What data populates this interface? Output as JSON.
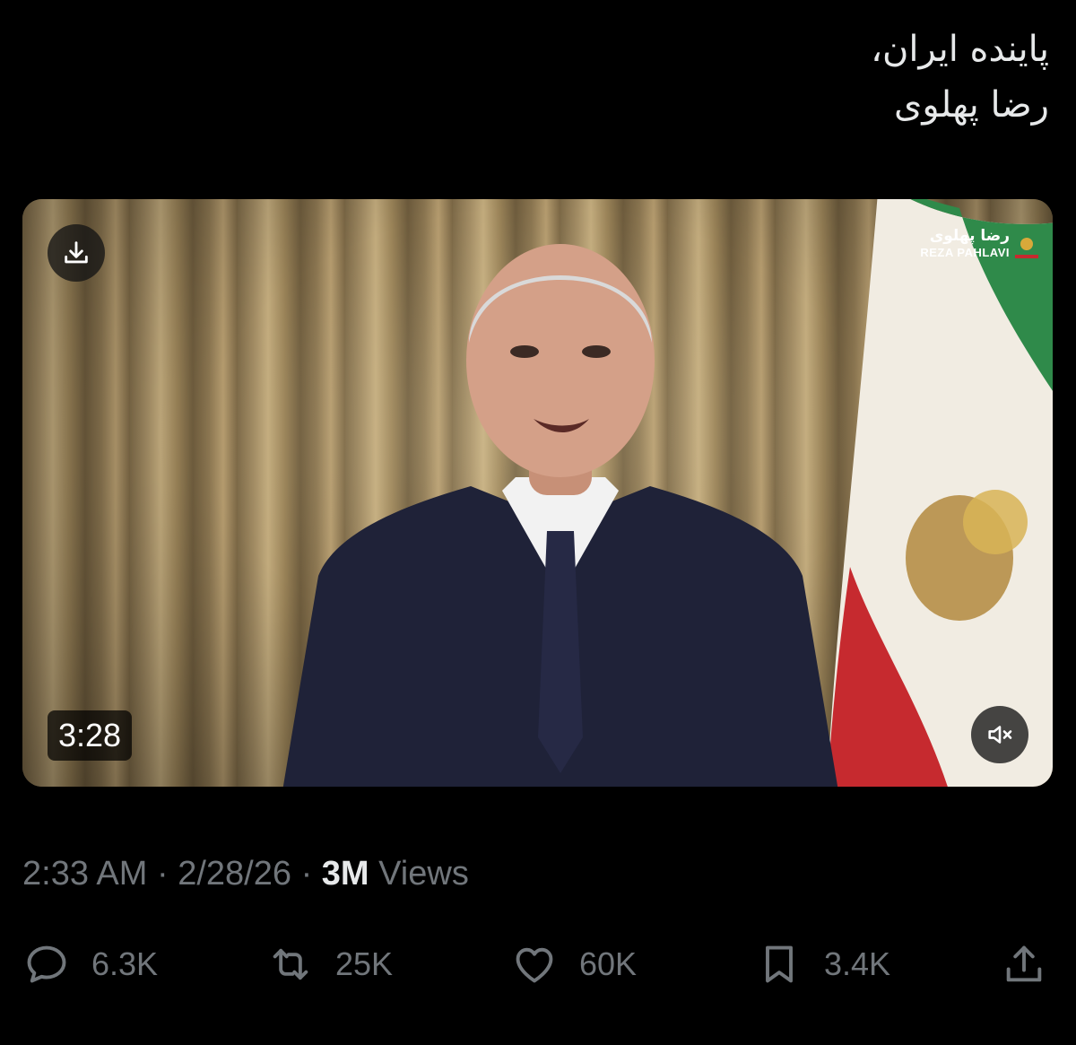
{
  "tweet": {
    "text_line1": "پاینده ایران،",
    "text_line2": "رضا پهلوی"
  },
  "video": {
    "duration": "3:28",
    "watermark_fa": "رضا پهلوی",
    "watermark_en": "REZA PAHLAVI",
    "download_icon": "download-icon",
    "mute_icon": "speaker-muted-icon"
  },
  "meta": {
    "time": "2:33 AM",
    "separator": "·",
    "date": "2/28/26",
    "views_count": "3M",
    "views_label": "Views"
  },
  "actions": {
    "replies": {
      "icon": "reply-icon",
      "count": "6.3K"
    },
    "reposts": {
      "icon": "repost-icon",
      "count": "25K"
    },
    "likes": {
      "icon": "heart-icon",
      "count": "60K"
    },
    "bookmarks": {
      "icon": "bookmark-icon",
      "count": "3.4K"
    },
    "share": {
      "icon": "share-icon"
    }
  },
  "colors": {
    "background": "#000000",
    "text_primary": "#e7e9ea",
    "text_secondary": "#71767b"
  }
}
